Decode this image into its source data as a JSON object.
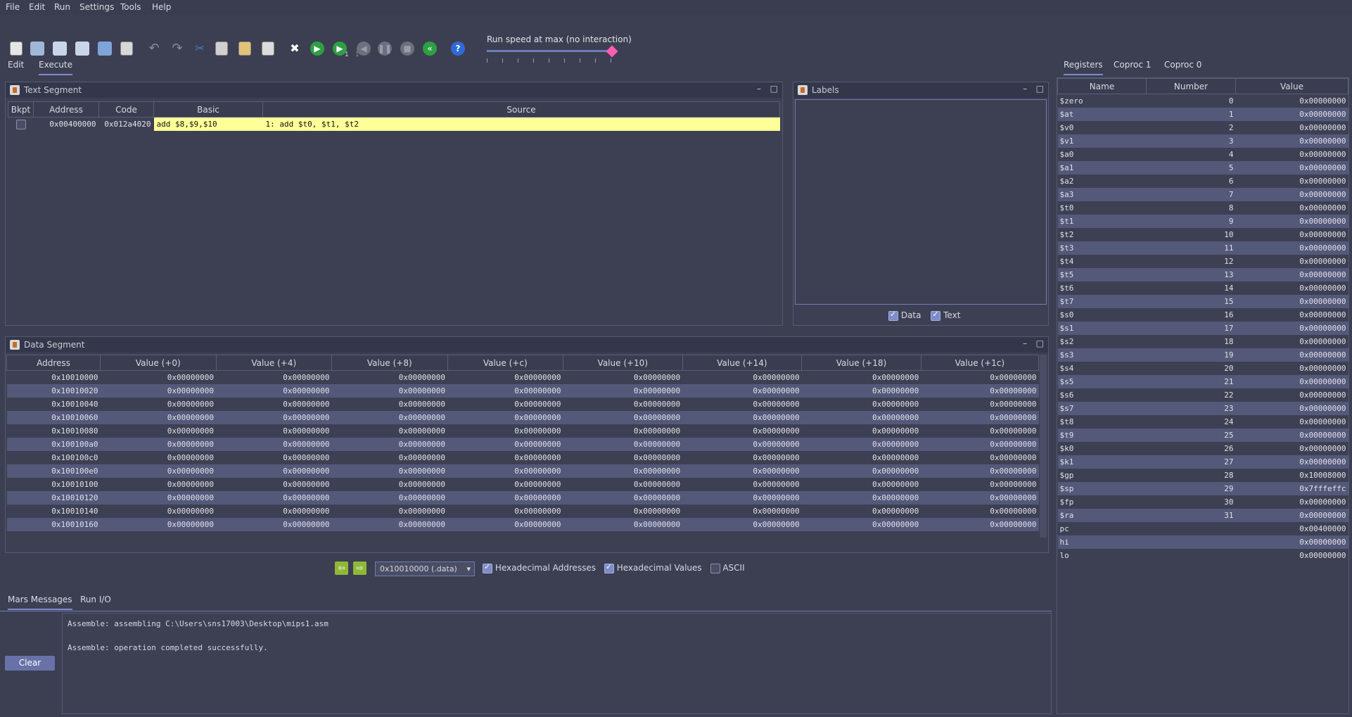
{
  "menu": [
    "File",
    "Edit",
    "Run",
    "Settings",
    "Tools",
    "Help"
  ],
  "toolbar": {
    "speed_label": "Run speed at max (no interaction)",
    "step_subscript": "1",
    "backstep_subscript": "1",
    "help_glyph": "?"
  },
  "main_tabs": [
    "Edit",
    "Execute"
  ],
  "text_segment": {
    "title": "Text Segment",
    "columns": [
      "Bkpt",
      "Address",
      "Code",
      "Basic",
      "Source"
    ],
    "rows": [
      {
        "address": "0x00400000",
        "code": "0x012a4020",
        "basic": "add $8,$9,$10",
        "source": "1: add $t0, $t1, $t2"
      }
    ]
  },
  "labels": {
    "title": "Labels",
    "data_label": "Data",
    "text_label": "Text"
  },
  "data_segment": {
    "title": "Data Segment",
    "columns": [
      "Address",
      "Value (+0)",
      "Value (+4)",
      "Value (+8)",
      "Value (+c)",
      "Value (+10)",
      "Value (+14)",
      "Value (+18)",
      "Value (+1c)"
    ],
    "addresses": [
      "0x10010000",
      "0x10010020",
      "0x10010040",
      "0x10010060",
      "0x10010080",
      "0x100100a0",
      "0x100100c0",
      "0x100100e0",
      "0x10010100",
      "0x10010120",
      "0x10010140",
      "0x10010160"
    ],
    "value": "0x00000000",
    "base_select": "0x10010000 (.data)",
    "hex_addresses_label": "Hexadecimal Addresses",
    "hex_values_label": "Hexadecimal Values",
    "ascii_label": "ASCII"
  },
  "messages": {
    "tabs": [
      "Mars Messages",
      "Run I/O"
    ],
    "clear_label": "Clear",
    "lines": [
      "Assemble: assembling C:\\Users\\sns17003\\Desktop\\mips1.asm",
      "",
      "Assemble: operation completed successfully."
    ]
  },
  "registers": {
    "tabs": [
      "Registers",
      "Coproc 1",
      "Coproc 0"
    ],
    "columns": [
      "Name",
      "Number",
      "Value"
    ],
    "rows": [
      {
        "name": "$zero",
        "number": "0",
        "value": "0x00000000"
      },
      {
        "name": "$at",
        "number": "1",
        "value": "0x00000000"
      },
      {
        "name": "$v0",
        "number": "2",
        "value": "0x00000000"
      },
      {
        "name": "$v1",
        "number": "3",
        "value": "0x00000000"
      },
      {
        "name": "$a0",
        "number": "4",
        "value": "0x00000000"
      },
      {
        "name": "$a1",
        "number": "5",
        "value": "0x00000000"
      },
      {
        "name": "$a2",
        "number": "6",
        "value": "0x00000000"
      },
      {
        "name": "$a3",
        "number": "7",
        "value": "0x00000000"
      },
      {
        "name": "$t0",
        "number": "8",
        "value": "0x00000000"
      },
      {
        "name": "$t1",
        "number": "9",
        "value": "0x00000000"
      },
      {
        "name": "$t2",
        "number": "10",
        "value": "0x00000000"
      },
      {
        "name": "$t3",
        "number": "11",
        "value": "0x00000000"
      },
      {
        "name": "$t4",
        "number": "12",
        "value": "0x00000000"
      },
      {
        "name": "$t5",
        "number": "13",
        "value": "0x00000000"
      },
      {
        "name": "$t6",
        "number": "14",
        "value": "0x00000000"
      },
      {
        "name": "$t7",
        "number": "15",
        "value": "0x00000000"
      },
      {
        "name": "$s0",
        "number": "16",
        "value": "0x00000000"
      },
      {
        "name": "$s1",
        "number": "17",
        "value": "0x00000000"
      },
      {
        "name": "$s2",
        "number": "18",
        "value": "0x00000000"
      },
      {
        "name": "$s3",
        "number": "19",
        "value": "0x00000000"
      },
      {
        "name": "$s4",
        "number": "20",
        "value": "0x00000000"
      },
      {
        "name": "$s5",
        "number": "21",
        "value": "0x00000000"
      },
      {
        "name": "$s6",
        "number": "22",
        "value": "0x00000000"
      },
      {
        "name": "$s7",
        "number": "23",
        "value": "0x00000000"
      },
      {
        "name": "$t8",
        "number": "24",
        "value": "0x00000000"
      },
      {
        "name": "$t9",
        "number": "25",
        "value": "0x00000000"
      },
      {
        "name": "$k0",
        "number": "26",
        "value": "0x00000000"
      },
      {
        "name": "$k1",
        "number": "27",
        "value": "0x00000000"
      },
      {
        "name": "$gp",
        "number": "28",
        "value": "0x10008000"
      },
      {
        "name": "$sp",
        "number": "29",
        "value": "0x7fffeffc"
      },
      {
        "name": "$fp",
        "number": "30",
        "value": "0x00000000"
      },
      {
        "name": "$ra",
        "number": "31",
        "value": "0x00000000"
      },
      {
        "name": "pc",
        "number": "",
        "value": "0x00400000"
      },
      {
        "name": "hi",
        "number": "",
        "value": "0x00000000"
      },
      {
        "name": "lo",
        "number": "",
        "value": "0x00000000"
      }
    ]
  },
  "colors": {
    "highlight": "#ffff99",
    "accent": "#7f8cc9",
    "slider_thumb": "#ff5fb0"
  }
}
